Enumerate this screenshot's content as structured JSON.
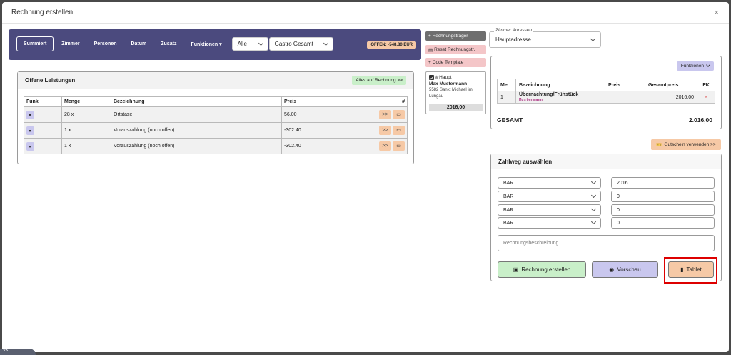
{
  "modal": {
    "title": "Rechnung erstellen",
    "close": "×"
  },
  "tabs": [
    {
      "label": "Summiert",
      "active": true
    },
    {
      "label": "Zimmer"
    },
    {
      "label": "Personen"
    },
    {
      "label": "Datum"
    },
    {
      "label": "Zusatz"
    },
    {
      "label": "Funktionen ▾"
    }
  ],
  "filters": {
    "all": "Alle",
    "gastro": "Gastro Gesamt"
  },
  "offen_badge": "OFFEN: -548,80 EUR",
  "open_items": {
    "title": "Offene Leistungen",
    "all_to_invoice": "Alles auf Rechnung >>",
    "columns": [
      "Funk",
      "Menge",
      "Bezeichnung",
      "Preis",
      "#"
    ],
    "rows": [
      {
        "menge": "28 x",
        "bezeichnung": "Ortstaxe",
        "preis": "56.00"
      },
      {
        "menge": "1 x",
        "bezeichnung": "Vorauszahlung (noch offen)",
        "preis": "-302.40"
      },
      {
        "menge": "1 x",
        "bezeichnung": "Vorauszahlung (noch offen)",
        "preis": "-302.40"
      }
    ],
    "move_label": ">>"
  },
  "side": {
    "add_recipient": "+ Rechnungsträger",
    "reset_recipient": "Reset Rechnungstr.",
    "code_template": "Code Template"
  },
  "recipient_card": {
    "label": "Haupt",
    "name": "Max Mustermann",
    "address": "5582 Sankt Michael im Lungau",
    "total": "2016,00"
  },
  "room_address": {
    "legend": "Zimmer Adressen",
    "value": "Hauptadresse"
  },
  "invoice_items": {
    "functions": "Funktionen",
    "columns": [
      "Me",
      "Bezeichnung",
      "Preis",
      "Gesamtpreis",
      "FK"
    ],
    "rows": [
      {
        "me": "1",
        "bezeichnung": "Übernachtung/Frühstück",
        "tag": "Mustermann",
        "preis": "",
        "gesamt": "2016.00",
        "fk": "×"
      }
    ],
    "total_label": "GESAMT",
    "total_value": "2.016,00"
  },
  "voucher": "Gutschein verwenden >>",
  "payment": {
    "title": "Zahlweg auswählen",
    "methods": [
      "BAR",
      "BAR",
      "BAR",
      "BAR"
    ],
    "amounts": [
      "2016",
      "0",
      "0",
      "0"
    ],
    "description_placeholder": "Rechnungsbeschreibung",
    "create": "Rechnung erstellen",
    "preview": "Vorschau",
    "tablet": "Tablet"
  },
  "colors": {
    "topbar": "#4b4a7e",
    "accent_orange": "#f6c9a6",
    "accent_purple": "#c9c7ee",
    "accent_green": "#c9efc9",
    "highlight": "#dd0000"
  },
  "corner_badge": "VK"
}
